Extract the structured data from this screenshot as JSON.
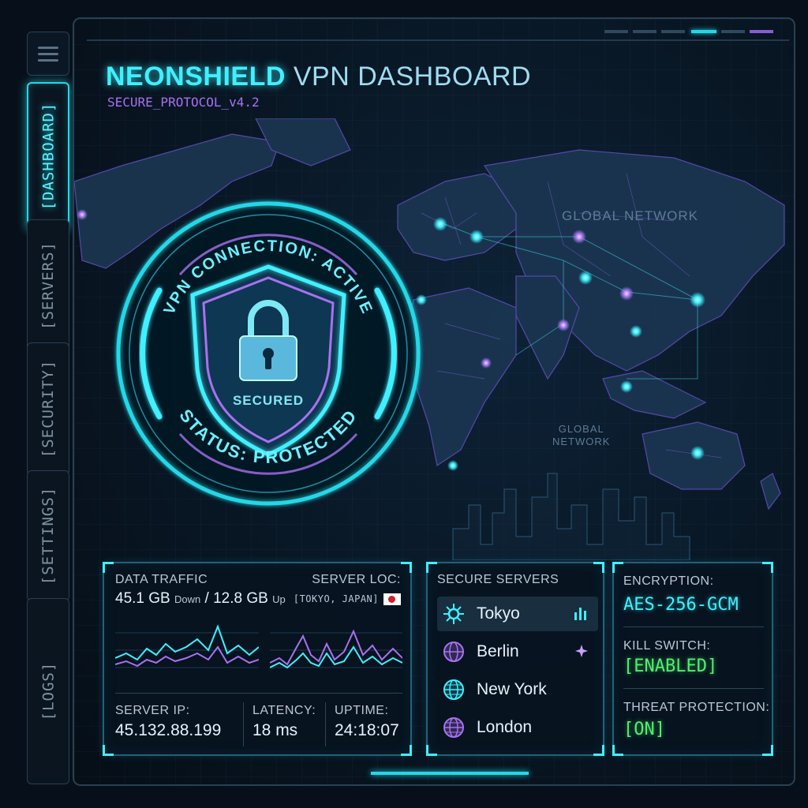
{
  "header": {
    "brand": "NEONSHIELD",
    "title_rest": "VPN DASHBOARD",
    "subtitle": "SECURE_PROTOCOL_v4.2"
  },
  "sidebar": {
    "items": [
      {
        "label": "[DASHBOARD]",
        "active": true
      },
      {
        "label": "[SERVERS]",
        "active": false
      },
      {
        "label": "[SECURITY]",
        "active": false
      },
      {
        "label": "[SETTINGS]",
        "active": false
      },
      {
        "label": "[LOGS]",
        "active": false
      }
    ]
  },
  "map": {
    "label_top": "GLOBAL NETWORK",
    "label_mid_line1": "GLOBAL",
    "label_mid_line2": "NETWORK"
  },
  "status_ring": {
    "connection": "VPN CONNECTION: ACTIVE",
    "status": "STATUS: PROTECTED",
    "shield_label": "SECURED"
  },
  "traffic_panel": {
    "data_traffic_label": "DATA TRAFFIC",
    "down_value": "45.1 GB",
    "down_unit": "Down",
    "separator": "/",
    "up_value": "12.8 GB",
    "up_unit": "Up",
    "server_loc_label": "SERVER LOC:",
    "server_loc_value": "[TOKYO, JAPAN]",
    "server_ip_label": "SERVER IP:",
    "server_ip_value": "45.132.88.199",
    "latency_label": "LATENCY:",
    "latency_value": "18 ms",
    "uptime_label": "UPTIME:",
    "uptime_value": "24:18:07"
  },
  "servers_panel": {
    "title": "SECURE SERVERS",
    "servers": [
      {
        "name": "Tokyo",
        "icon": "network-node-icon",
        "selected": true
      },
      {
        "name": "Berlin",
        "icon": "globe-icon",
        "selected": false
      },
      {
        "name": "New York",
        "icon": "globe-icon",
        "selected": false
      },
      {
        "name": "London",
        "icon": "globe-icon",
        "selected": false
      }
    ]
  },
  "security_panel": {
    "encryption_label": "ENCRYPTION:",
    "encryption_value": "AES-256-GCM",
    "kill_switch_label": "KILL SWITCH:",
    "kill_switch_value": "[ENABLED]",
    "threat_label": "THREAT PROTECTION:",
    "threat_value": "[ON]"
  },
  "colors": {
    "accent_cyan": "#22d8e8",
    "accent_purple": "#a871f0",
    "status_green": "#4ff06a",
    "background": "#07101a"
  }
}
